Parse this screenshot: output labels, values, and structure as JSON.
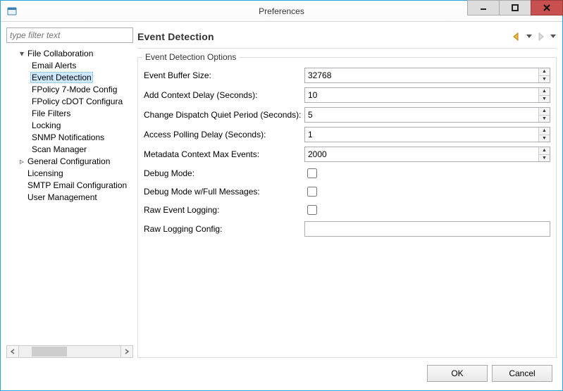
{
  "window": {
    "title": "Preferences"
  },
  "filter": {
    "placeholder": "type filter text"
  },
  "tree": {
    "items": [
      {
        "label": "File Collaboration",
        "expanded": true,
        "depth": 1,
        "selected": false,
        "expander": "▾"
      },
      {
        "label": "Email Alerts",
        "depth": 2,
        "selected": false
      },
      {
        "label": "Event Detection",
        "depth": 2,
        "selected": true
      },
      {
        "label": "FPolicy 7-Mode Config",
        "depth": 2,
        "selected": false
      },
      {
        "label": "FPolicy cDOT Configura",
        "depth": 2,
        "selected": false
      },
      {
        "label": "File Filters",
        "depth": 2,
        "selected": false
      },
      {
        "label": "Locking",
        "depth": 2,
        "selected": false
      },
      {
        "label": "SNMP Notifications",
        "depth": 2,
        "selected": false
      },
      {
        "label": "Scan Manager",
        "depth": 2,
        "selected": false
      },
      {
        "label": "General Configuration",
        "depth": 1,
        "selected": false,
        "expander": "▹"
      },
      {
        "label": "Licensing",
        "depth": 1,
        "selected": false,
        "expander": ""
      },
      {
        "label": "SMTP Email Configuration",
        "depth": 1,
        "selected": false,
        "expander": ""
      },
      {
        "label": "User Management",
        "depth": 1,
        "selected": false,
        "expander": ""
      }
    ]
  },
  "page": {
    "title": "Event Detection",
    "group_title": "Event Detection Options"
  },
  "fields": {
    "event_buffer_size": {
      "label": "Event Buffer Size:",
      "value": "32768",
      "type": "spin"
    },
    "add_context_delay": {
      "label": "Add Context Delay (Seconds):",
      "value": "10",
      "type": "spin"
    },
    "change_dispatch": {
      "label": "Change Dispatch Quiet Period (Seconds):",
      "value": "5",
      "type": "spin"
    },
    "access_polling": {
      "label": "Access Polling Delay (Seconds):",
      "value": "1",
      "type": "spin"
    },
    "metadata_max": {
      "label": "Metadata Context Max Events:",
      "value": "2000",
      "type": "spin"
    },
    "debug_mode": {
      "label": "Debug Mode:",
      "checked": false,
      "type": "check"
    },
    "debug_full": {
      "label": "Debug Mode w/Full Messages:",
      "checked": false,
      "type": "check"
    },
    "raw_event_logging": {
      "label": "Raw Event Logging:",
      "checked": false,
      "type": "check"
    },
    "raw_logging_config": {
      "label": "Raw Logging Config:",
      "value": "",
      "type": "text"
    }
  },
  "buttons": {
    "ok": "OK",
    "cancel": "Cancel"
  }
}
